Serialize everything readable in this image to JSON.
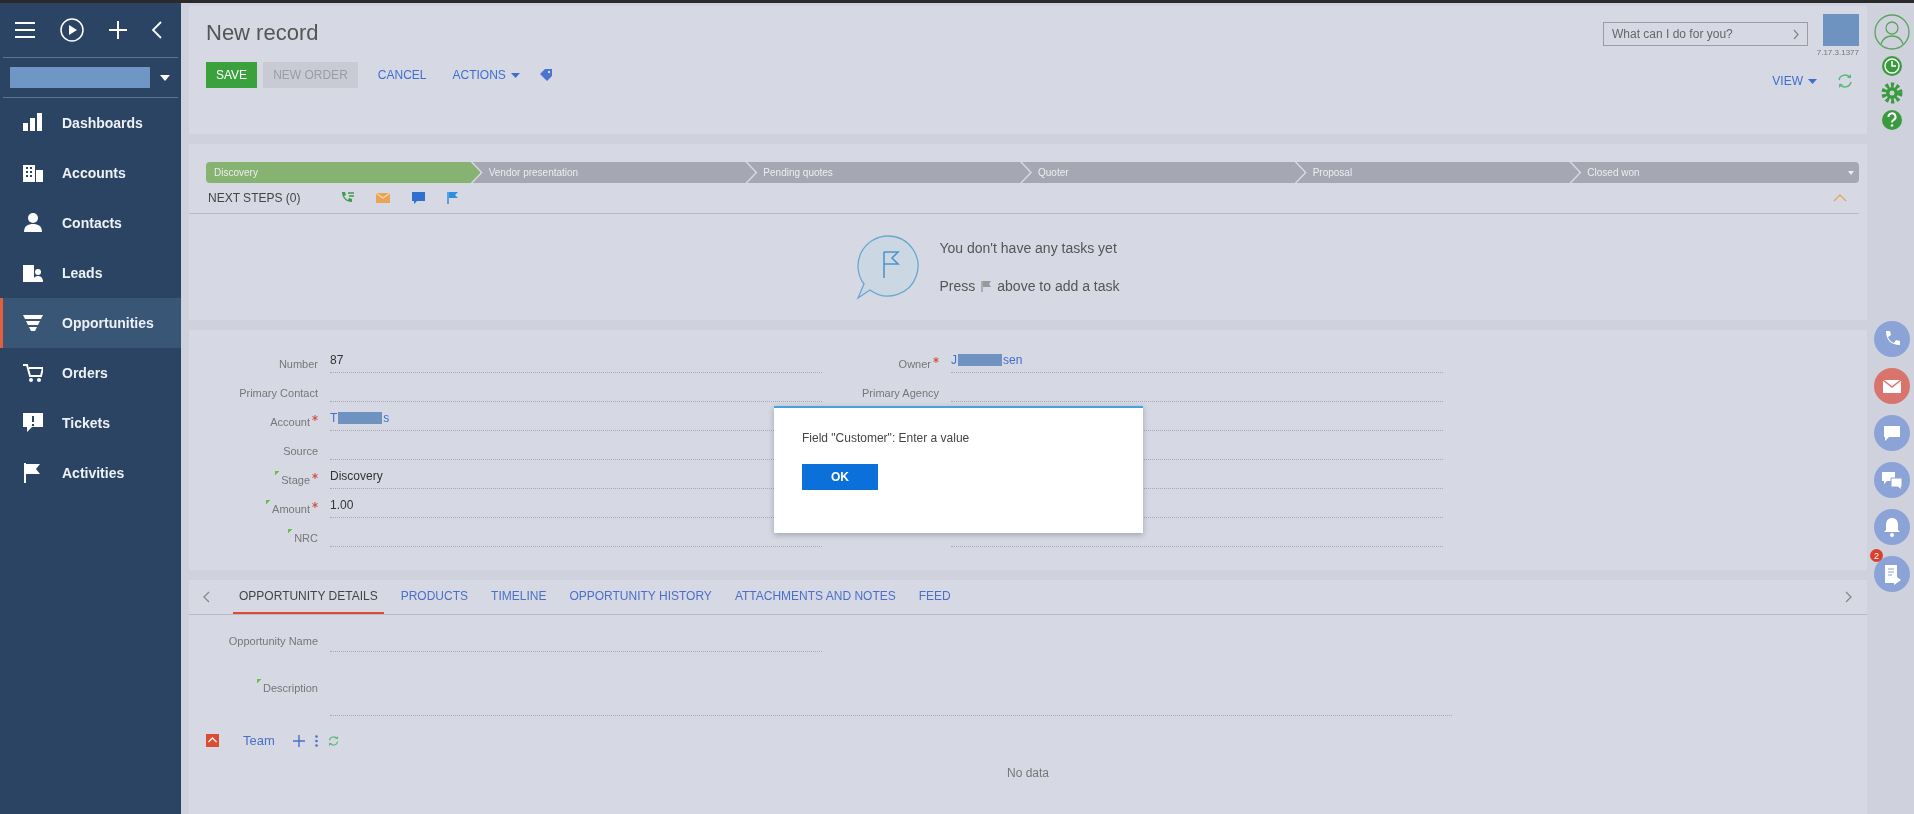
{
  "sidebar": {
    "items": [
      {
        "label": "Dashboards",
        "selected": false
      },
      {
        "label": "Accounts",
        "selected": false
      },
      {
        "label": "Contacts",
        "selected": false
      },
      {
        "label": "Leads",
        "selected": false
      },
      {
        "label": "Opportunities",
        "selected": true
      },
      {
        "label": "Orders",
        "selected": false
      },
      {
        "label": "Tickets",
        "selected": false
      },
      {
        "label": "Activities",
        "selected": false
      }
    ]
  },
  "header": {
    "title": "New record",
    "buttons": [
      {
        "label": "SAVE",
        "kind": "primary"
      },
      {
        "label": "NEW ORDER",
        "kind": "disabled"
      },
      {
        "label": "CANCEL",
        "kind": "link"
      },
      {
        "label": "ACTIONS",
        "kind": "dropdown"
      }
    ],
    "search": {
      "placeholder": "What can I do for you?"
    },
    "version": "7.17.3.1377",
    "view": "VIEW"
  },
  "stages": [
    {
      "label": "Discovery",
      "selected": true
    },
    {
      "label": "Vendor presentation",
      "selected": false
    },
    {
      "label": "Pending quotes",
      "selected": false
    },
    {
      "label": "Quoter",
      "selected": false
    },
    {
      "label": "Proposal",
      "selected": false
    },
    {
      "label": "Closed won",
      "selected": false
    }
  ],
  "next_steps": {
    "label": "NEXT STEPS (0)",
    "empty_title": "You don't have any tasks yet",
    "hint_before": "Press",
    "hint_after": "above to add a task"
  },
  "fields_left": [
    {
      "label": "Number",
      "required": false,
      "marker": false,
      "kind": "text",
      "value": "87"
    },
    {
      "label": "Primary Contact",
      "required": false,
      "marker": false,
      "kind": "text"
    },
    {
      "label": "Account",
      "required": true,
      "marker": false,
      "kind": "redacted",
      "value_start": "T",
      "value_end": "s"
    },
    {
      "label": "Source",
      "required": false,
      "marker": false,
      "kind": "text"
    },
    {
      "label": "Stage",
      "required": true,
      "marker": true,
      "kind": "text",
      "value": "Discovery"
    },
    {
      "label": "Amount",
      "required": true,
      "marker": true,
      "kind": "text",
      "value": "1.00"
    },
    {
      "label": "NRC",
      "required": false,
      "marker": true,
      "kind": "text"
    }
  ],
  "fields_right": [
    {
      "label": "Owner",
      "required": true,
      "marker": false,
      "kind": "redacted",
      "value_start": "J",
      "value_end": "sen"
    },
    {
      "label": "Primary Agency",
      "required": false,
      "marker": false,
      "kind": "text"
    },
    {
      "kind": "covered"
    },
    {
      "kind": "covered"
    },
    {
      "kind": "covered"
    },
    {
      "kind": "covered"
    },
    {
      "kind": "covered"
    }
  ],
  "tabs": [
    {
      "label": "OPPORTUNITY DETAILS",
      "selected": true
    },
    {
      "label": "PRODUCTS",
      "selected": false
    },
    {
      "label": "TIMELINE",
      "selected": false
    },
    {
      "label": "OPPORTUNITY HISTORY",
      "selected": false
    },
    {
      "label": "ATTACHMENTS AND NOTES",
      "selected": false
    },
    {
      "label": "FEED",
      "selected": false
    }
  ],
  "details": [
    {
      "label": "Opportunity Name",
      "marker": false,
      "kind": "line"
    },
    {
      "label": "Description",
      "marker": true,
      "kind": "area"
    }
  ],
  "team": {
    "title": "Team",
    "expanded": true,
    "empty": "No data"
  },
  "dialog": {
    "message": "Field \"Customer\": Enter a value",
    "button": "OK"
  },
  "rail": {
    "badge": "2"
  }
}
